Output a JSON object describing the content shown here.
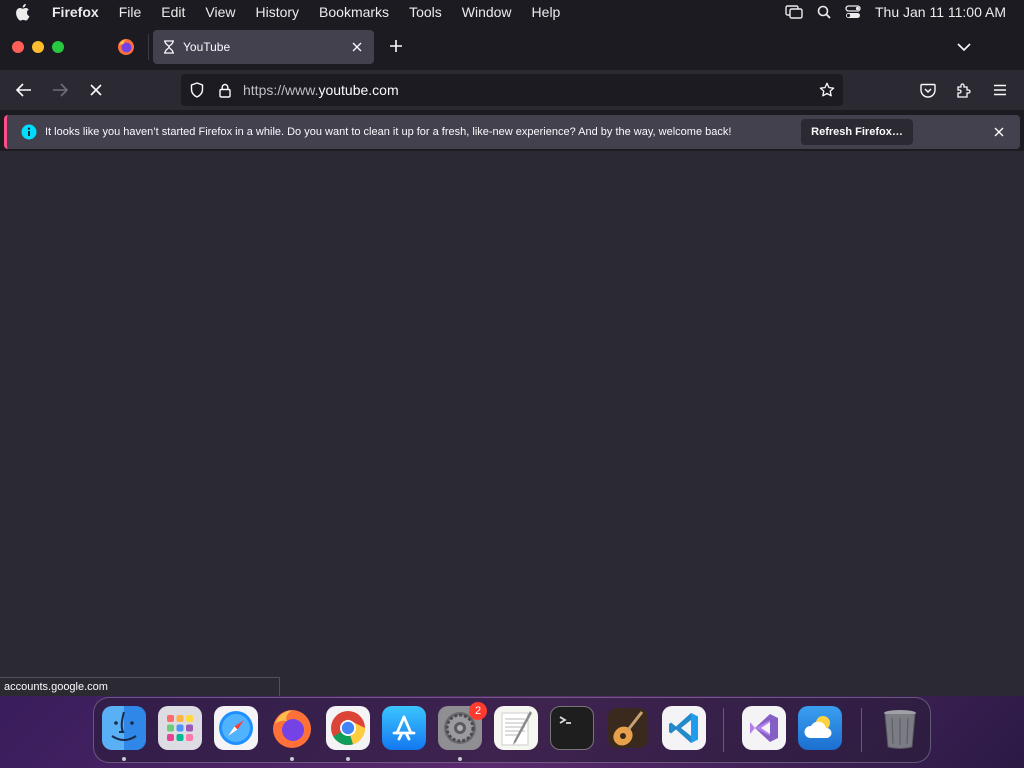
{
  "menubar": {
    "app_name": "Firefox",
    "items": [
      "File",
      "Edit",
      "View",
      "History",
      "Bookmarks",
      "Tools",
      "Window",
      "Help"
    ],
    "clock": "Thu Jan 11  11:00 AM"
  },
  "tabs": {
    "active_title": "YouTube"
  },
  "navbar": {
    "url_prefix": "https://www.",
    "url_domain": "youtube.com"
  },
  "notification": {
    "message": "It looks like you haven’t started Firefox in a while. Do you want to clean it up for a fresh, like-new experience? And by the way, welcome back!",
    "button_label": "Refresh Firefox…"
  },
  "status_url": "accounts.google.com",
  "dock": {
    "apps": [
      "Finder",
      "Launchpad",
      "Safari",
      "Firefox",
      "Google Chrome",
      "App Store",
      "System Settings",
      "TextEdit",
      "Terminal",
      "GarageBand",
      "Visual Studio Code",
      "Visual Studio",
      "Weather",
      "Trash"
    ],
    "settings_badge": "2"
  },
  "colors": {
    "accent": "#ff4f8b",
    "info": "#00ddff",
    "window_bg": "#1c1b22",
    "content_bg": "#2b2a33"
  }
}
